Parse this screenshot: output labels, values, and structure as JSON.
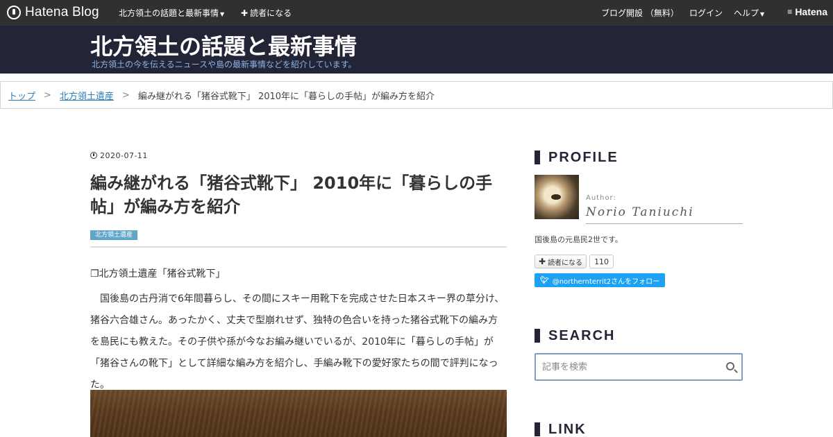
{
  "topbar": {
    "logo_text": "Hatena Blog",
    "blog_menu": "北方領土の話題と最新事情",
    "subscribe": "読者になる",
    "open_blog": "ブログ開設 （無料）",
    "login": "ログイン",
    "help": "ヘルプ",
    "brand": "Hatena"
  },
  "header": {
    "title": "北方領土の話題と最新事情",
    "description": "北方領土の今を伝えるニュースや島の最新事情などを紹介しています。"
  },
  "breadcrumb": {
    "items": [
      "トップ",
      "北方領土遺産"
    ],
    "current": "編み継がれる「猪谷式靴下」 2010年に「暮らしの手帖」が編み方を紹介",
    "separator": ">"
  },
  "article": {
    "date": "2020-07-11",
    "title": "編み継がれる「猪谷式靴下」 2010年に「暮らしの手帖」が編み方を紹介",
    "category": "北方領土遺産",
    "section_heading": "❐北方領土遺産「猪谷式靴下」",
    "body": "　国後島の古丹消で6年間暮らし、その間にスキー用靴下を完成させた日本スキー界の草分け、猪谷六合雄さん。あったかく、丈夫で型崩れせず、独特の色合いを持った猪谷式靴下の編み方を島民にも教えた。その子供や孫が今なお編み継いでいるが、2010年に「暮らしの手帖」が「猪谷さんの靴下」として詳細な編み方を紹介し、手編み靴下の愛好家たちの間で評判になった。"
  },
  "sidebar": {
    "profile_heading": "PROFILE",
    "author_label": "Author:",
    "author_name": "Norio Taniuchi",
    "profile_desc": "国後島の元島民2世です。",
    "subscribe_label": "読者になる",
    "subscriber_count": "110",
    "twitter_label": "@northernterrit2さんをフォロー",
    "search_heading": "SEARCH",
    "search_placeholder": "記事を検索",
    "link_heading": "LINK"
  }
}
